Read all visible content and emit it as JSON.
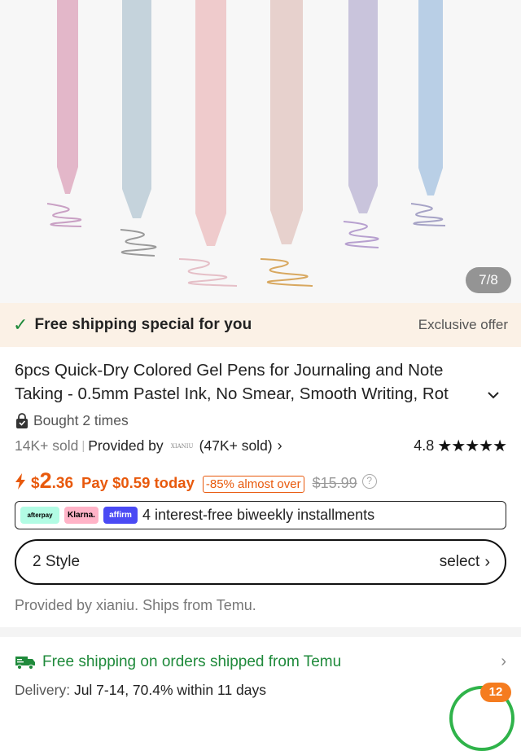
{
  "gallery": {
    "counter": "7/8"
  },
  "shipping_banner": {
    "text": "Free shipping special for you",
    "right_text": "Exclusive offer"
  },
  "product": {
    "title_line1": "6pcs Quick-Dry Colored Gel Pens for Journaling and Note",
    "title_line2": "Taking - 0.5mm Pastel Ink, No Smear, Smooth Writing, Rot",
    "bought": "Bought 2 times",
    "sold": "14K+ sold",
    "provided_by": "Provided by",
    "store_logo_text": "XIANIU",
    "store_sold": "(47K+ sold)",
    "rating": "4.8"
  },
  "price": {
    "currency": "$",
    "int": "2",
    "dec": ".36",
    "pay_today": "Pay $0.59 today",
    "discount": "-85% almost over",
    "original": "$15.99",
    "help": "?"
  },
  "installments": {
    "afterpay": "afterpay",
    "klarna": "Klarna.",
    "affirm": "affirm",
    "text": "4 interest-free biweekly installments"
  },
  "style_selector": {
    "label": "2 Style",
    "action": "select"
  },
  "provided_note": "Provided by xianiu. Ships from Temu.",
  "shipping": {
    "text": "Free shipping on orders shipped from Temu",
    "delivery_label": "Delivery:",
    "delivery_value": "Jul 7-14, 70.4% within 11 days"
  },
  "cart": {
    "badge": "12"
  },
  "colors": {
    "accent_orange": "#e8590c",
    "green": "#1f8a3b",
    "banner_bg": "#fbf1e6"
  }
}
